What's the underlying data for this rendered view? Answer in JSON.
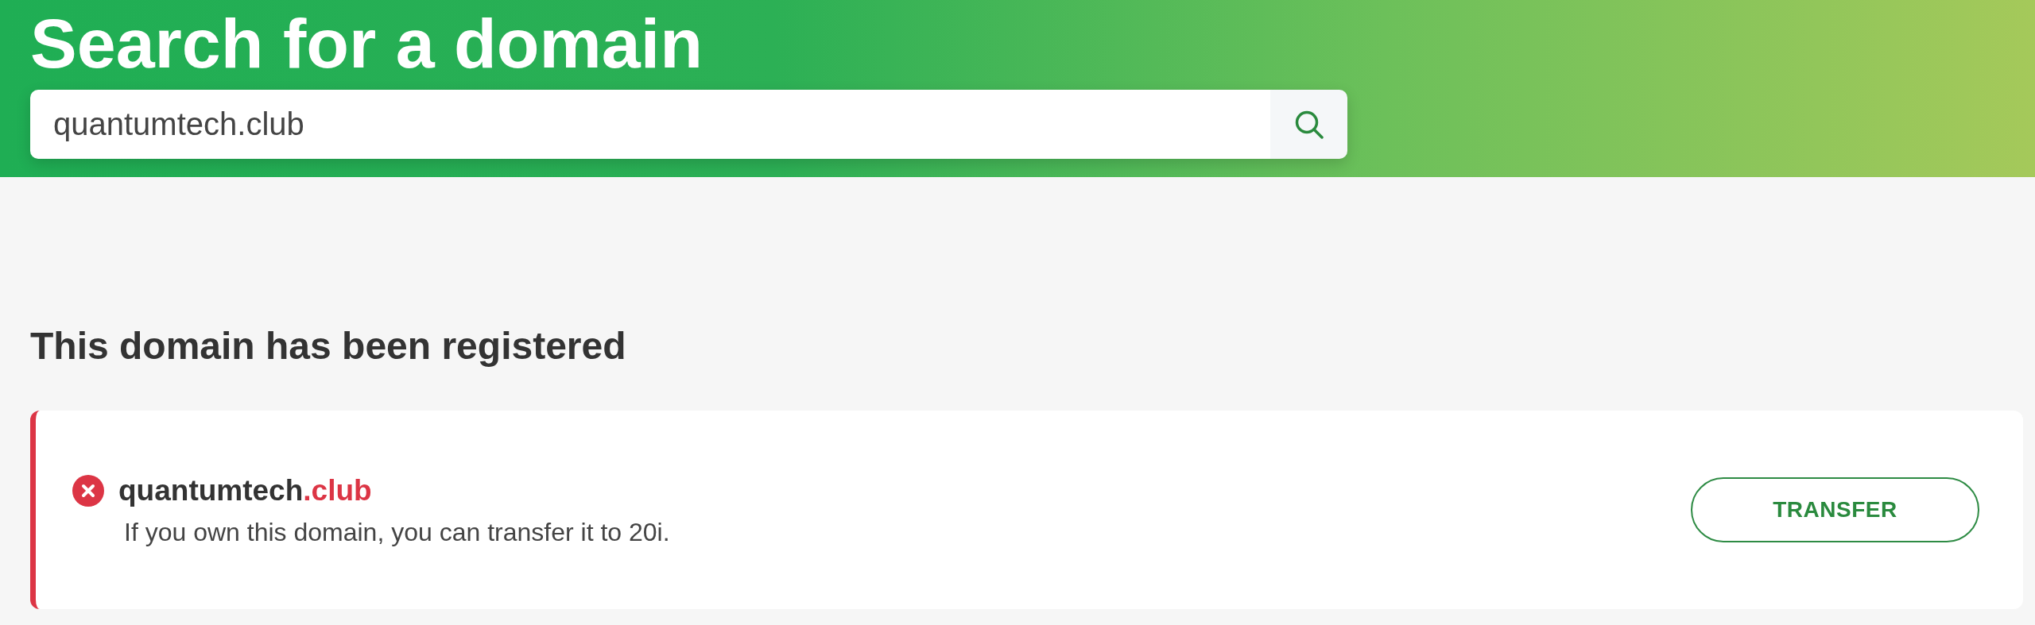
{
  "header": {
    "title": "Search for a domain",
    "search": {
      "value": "quantumtech.club"
    }
  },
  "results": {
    "heading": "This domain has been registered",
    "items": [
      {
        "name": "quantumtech",
        "tld": ".club",
        "available": false,
        "message": "If you own this domain, you can transfer it to 20i.",
        "action": "TRANSFER"
      }
    ]
  }
}
